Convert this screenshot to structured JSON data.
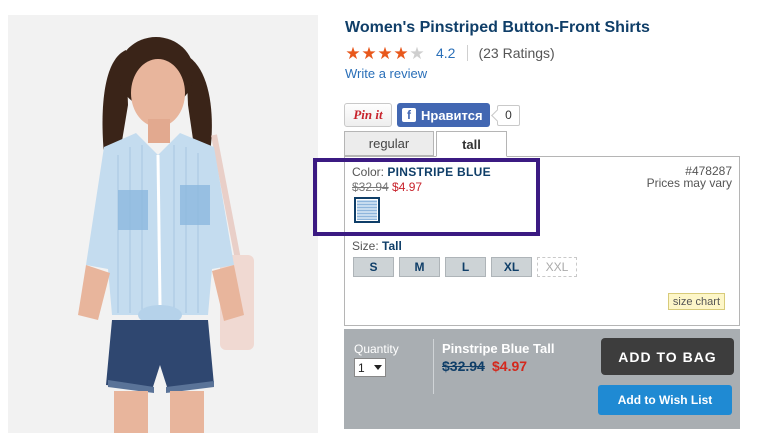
{
  "product": {
    "title": "Women's Pinstriped Button-Front Shirts",
    "image_alt": "model-wearing-pinstriped-shirt"
  },
  "rating": {
    "stars_filled": 4.2,
    "stars_max": 5,
    "value": "4.2",
    "count_text": "(23 Ratings)",
    "write_review": "Write a review"
  },
  "social": {
    "pin_label": "Pin it",
    "fb_label": "Нравится",
    "fb_count": "0"
  },
  "tabs": [
    {
      "label": "regular",
      "selected": false
    },
    {
      "label": "tall",
      "selected": true
    }
  ],
  "color": {
    "label": "Color: ",
    "value": "PINSTRIPE BLUE",
    "old_price": "$32.94",
    "new_price": "$4.97",
    "swatch_icon": "pinstripe-blue-swatch"
  },
  "sku": "#478287",
  "prices_vary": "Prices may vary",
  "size": {
    "label": "Size: ",
    "value": "Tall",
    "options": [
      {
        "label": "S",
        "available": true
      },
      {
        "label": "M",
        "available": true
      },
      {
        "label": "L",
        "available": true
      },
      {
        "label": "XL",
        "available": true
      },
      {
        "label": "XXL",
        "available": false
      }
    ],
    "chart_label": "size chart"
  },
  "buy": {
    "qty_label": "Quantity",
    "qty_value": "1",
    "item_name": "Pinstripe Blue Tall",
    "old_price": "$32.94",
    "new_price": "$4.97",
    "add_to_bag": "ADD TO BAG",
    "wishlist": "Add to Wish List"
  },
  "colors": {
    "brand_blue": "#0f3e68",
    "link_blue": "#2a6fb8",
    "sale_red": "#c8232c",
    "star_orange": "#e8581c",
    "highlight_purple": "#3b1a82"
  }
}
